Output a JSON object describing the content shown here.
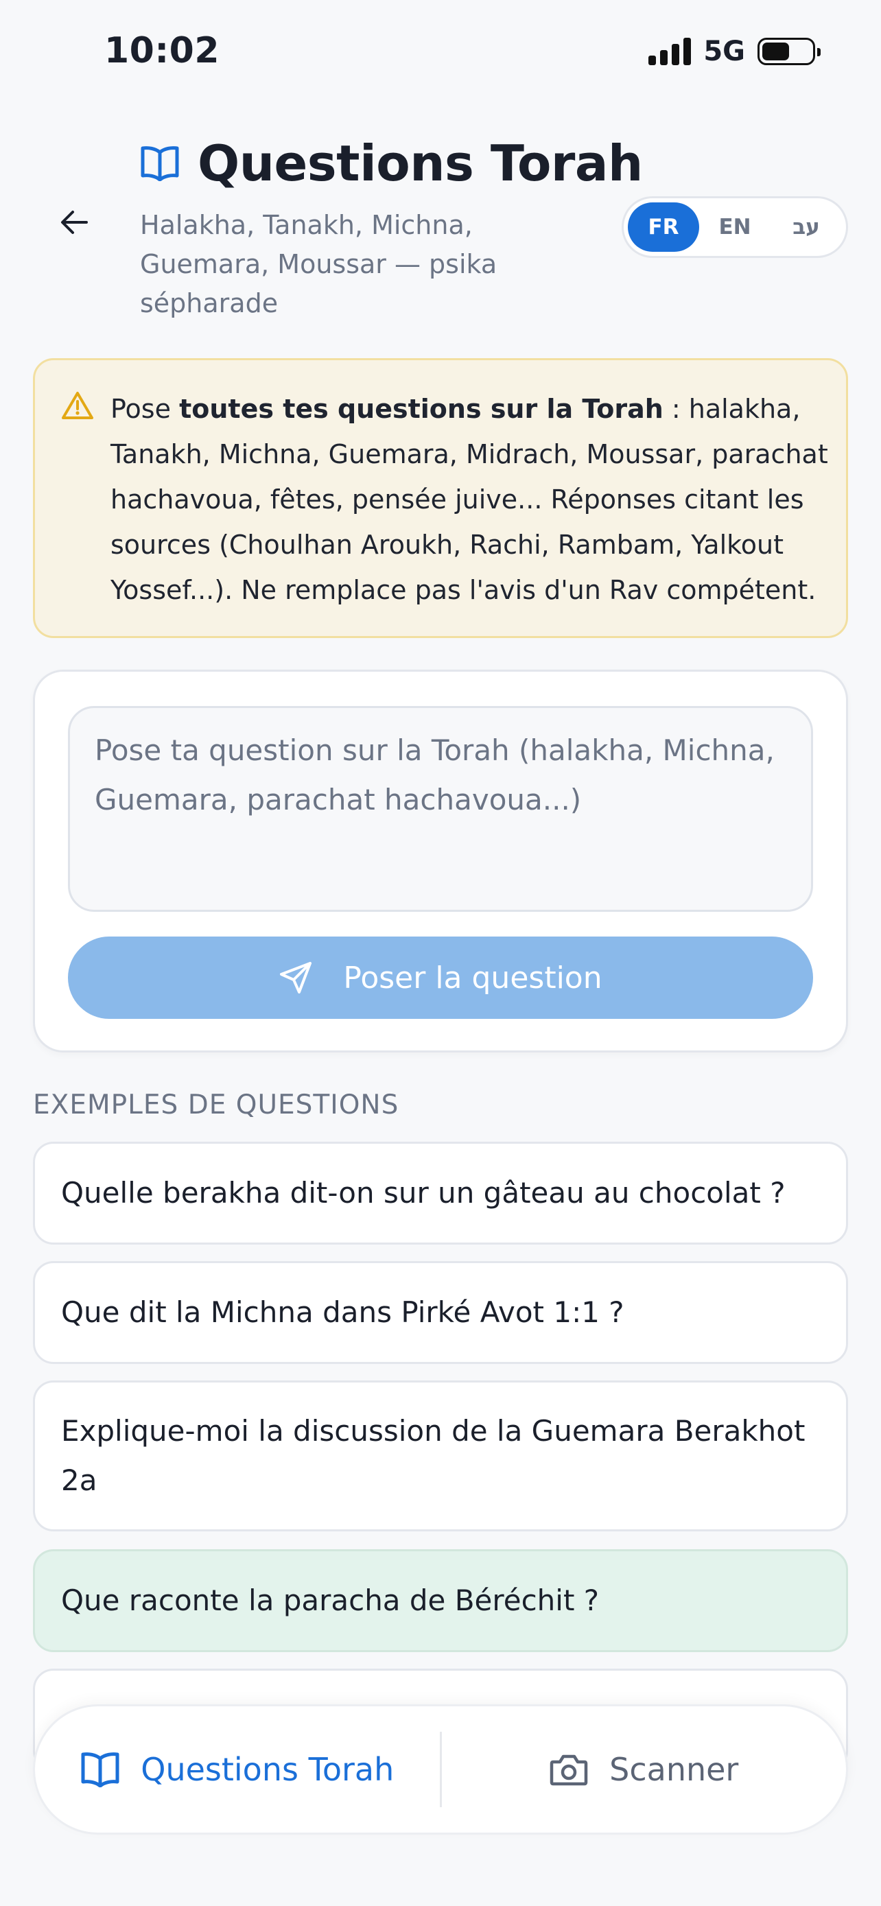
{
  "status": {
    "time": "10:02",
    "network": "5G"
  },
  "header": {
    "title": "Questions Torah",
    "subtitle": "Halakha, Tanakh, Michna, Guemara, Moussar — psika sépharade"
  },
  "languages": [
    {
      "code": "FR",
      "active": true
    },
    {
      "code": "EN",
      "active": false
    },
    {
      "code": "עב",
      "active": false
    }
  ],
  "warning": {
    "prefix": "Pose ",
    "bold": "toutes tes questions sur la Torah",
    "body": " : halakha, Tanakh, Michna, Guemara, Midrach, Moussar, parachat hachavoua, fêtes, pensée juive... Réponses citant les sources (Choulhan Aroukh, Rachi, Rambam, Yalkout Yossef...). Ne remplace pas l'avis d'un Rav compétent."
  },
  "question": {
    "placeholder": "Pose ta question sur la Torah (halakha, Michna, Guemara, parachat hachavoua...)",
    "value": "",
    "submit_label": "Poser la question"
  },
  "examples": {
    "label": "EXEMPLES DE QUESTIONS",
    "items": [
      "Quelle berakha dit-on sur un gâteau au chocolat ?",
      "Que dit la Michna dans Pirké Avot 1:1 ?",
      "Explique-moi la discussion de la Guemara Berakhot 2a",
      "Que raconte la paracha de Béréchit ?"
    ]
  },
  "bottom_nav": {
    "tabs": [
      {
        "label": "Questions Torah",
        "icon": "book-icon",
        "active": true
      },
      {
        "label": "Scanner",
        "icon": "camera-icon",
        "active": false
      }
    ]
  },
  "colors": {
    "accent": "#1a6fd8",
    "button_disabled": "#8ab9ea",
    "warning_bg": "#f8f3e5",
    "warning_border": "#f2dfa0",
    "warning_icon": "#e3a814",
    "highlight_bg": "#e3f3ec"
  }
}
